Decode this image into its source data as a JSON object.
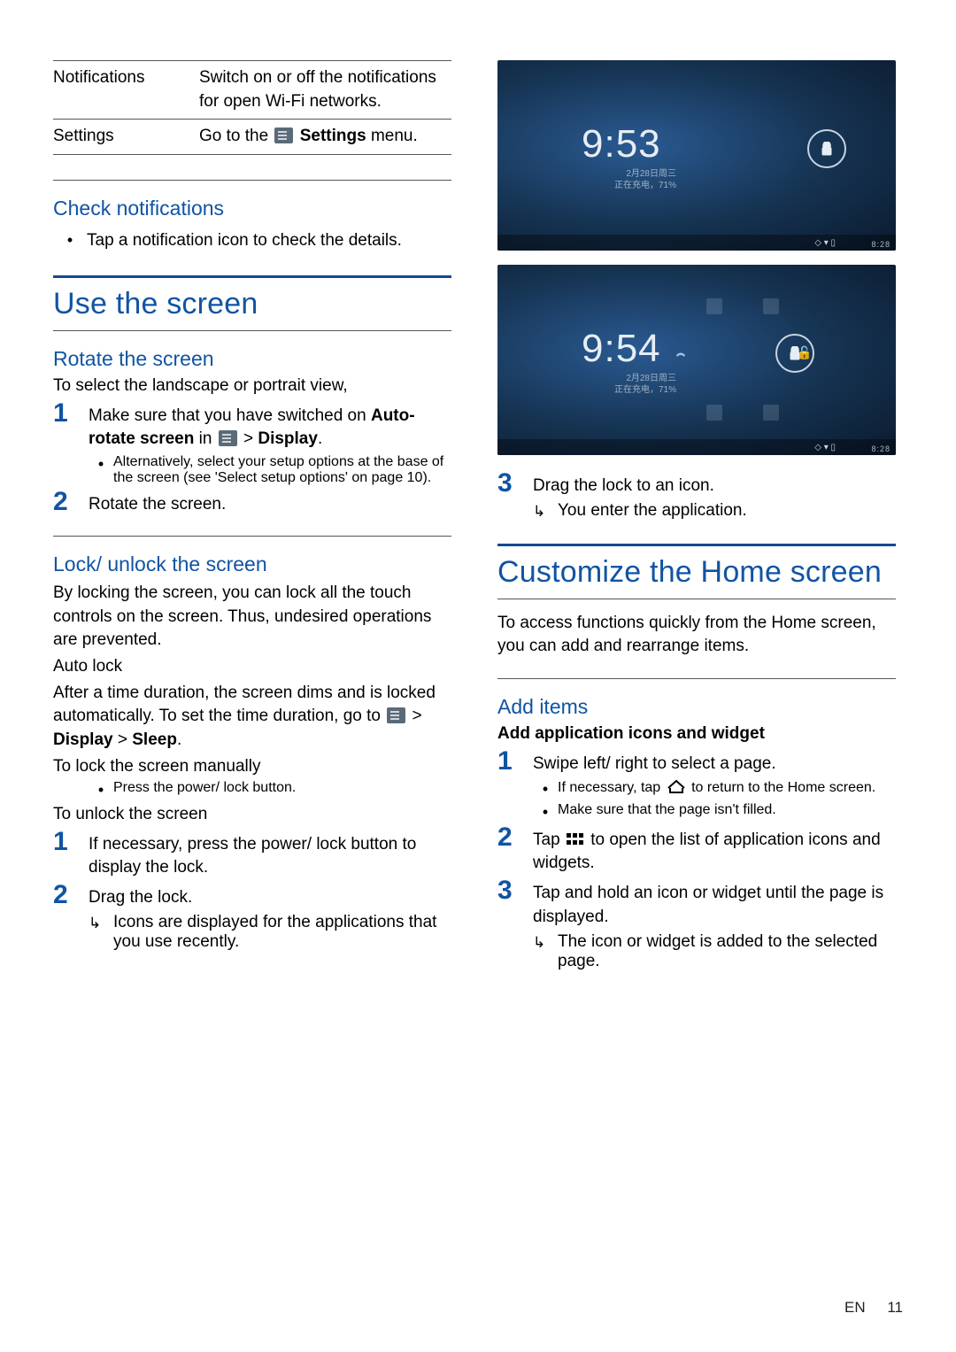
{
  "table": {
    "r1": {
      "c1": "Notifications",
      "c2": "Switch on or off the notifications for open Wi-Fi networks."
    },
    "r2": {
      "c1": "Settings",
      "c2a": "Go to the ",
      "c2b": " Settings",
      "c2c": " menu."
    }
  },
  "check": {
    "h": "Check notifications",
    "b1": "Tap a notification icon to check the details."
  },
  "use": {
    "h": "Use the screen"
  },
  "rotate": {
    "h": "Rotate the screen",
    "lead": "To select the landscape or portrait view,",
    "s1a": "Make sure that you have switched on ",
    "s1b": "Auto-rotate screen",
    "s1c": " in ",
    "s1d": " > ",
    "s1e": "Display",
    "s1f": ".",
    "s1_sub": "Alternatively, select your setup options at the base of the screen (see 'Select setup options' on page 10).",
    "s2": "Rotate the screen."
  },
  "lock": {
    "h": "Lock/ unlock the screen",
    "p1": "By locking the screen, you can lock all the touch controls on the screen. Thus, undesired operations are prevented.",
    "auto_h": "Auto lock",
    "auto_p_a": "After a time duration, the screen dims and is locked automatically. To set the time duration, go to ",
    "auto_p_b": " > ",
    "auto_p_c": "Display",
    "auto_p_d": " > ",
    "auto_p_e": "Sleep",
    "auto_p_f": ".",
    "man_h": "To lock the screen manually",
    "man_b": "Press the power/ lock button.",
    "unl_h": "To unlock the screen",
    "unl_s1": "If necessary, press the power/ lock button to display the lock.",
    "unl_s2": "Drag the lock.",
    "unl_s2_res": "Icons are displayed for the applications that you use recently."
  },
  "shots": {
    "t1": "9:53",
    "t2": "9:54",
    "d1a": "2月28日周三",
    "d1b": "正在充电，71%",
    "d2a": "2月28日周三",
    "d2b": "正在充电，71%",
    "bar": "8:28"
  },
  "right_step3": {
    "s3": "Drag the lock to an icon.",
    "s3_res": "You enter the application."
  },
  "custom": {
    "h": "Customize the Home screen",
    "p": "To access functions quickly from the Home screen, you can add and rearrange items."
  },
  "add": {
    "h": "Add items",
    "sub_h": "Add application icons and widget",
    "s1": "Swipe left/ right to select a page.",
    "s1_b1a": "If necessary, tap ",
    "s1_b1b": " to return to the Home screen.",
    "s1_b2": "Make sure that the page isn't filled.",
    "s2a": "Tap ",
    "s2b": " to open the list of application icons and widgets.",
    "s3": "Tap and hold an icon or widget until the page is displayed.",
    "s3_res": "The icon or widget is added to the selected page."
  },
  "footer": {
    "lang": "EN",
    "page": "11"
  }
}
